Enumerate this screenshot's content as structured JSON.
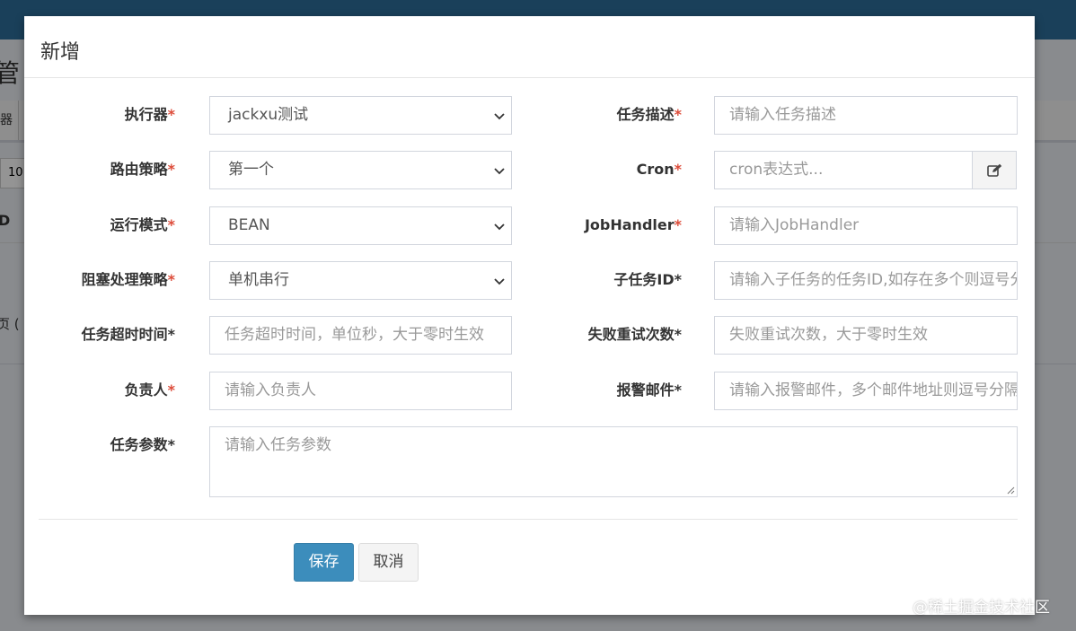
{
  "background": {
    "title_fragment": "管",
    "table_cell": "器",
    "page_size": "10",
    "id_col": "D",
    "page_info": "页 ( 总"
  },
  "modal": {
    "title": "新增",
    "fields": {
      "executor": {
        "label": "执行器",
        "required_mark": "*",
        "value": "jackxu测试"
      },
      "job_desc": {
        "label": "任务描述",
        "required_mark": "*",
        "placeholder": "请输入任务描述"
      },
      "route_strategy": {
        "label": "路由策略",
        "required_mark": "*",
        "value": "第一个"
      },
      "cron": {
        "label": "Cron",
        "required_mark": "*",
        "placeholder": "cron表达式...",
        "icon": "edit-icon"
      },
      "run_mode": {
        "label": "运行模式",
        "required_mark": "*",
        "value": "BEAN"
      },
      "job_handler": {
        "label": "JobHandler",
        "required_mark": "*",
        "placeholder": "请输入JobHandler"
      },
      "block_strategy": {
        "label": "阻塞处理策略",
        "required_mark": "*",
        "value": "单机串行"
      },
      "child_job_id": {
        "label": "子任务ID",
        "required_mark": "*",
        "placeholder": "请输入子任务的任务ID,如存在多个则逗号分隔"
      },
      "timeout": {
        "label": "任务超时时间",
        "required_mark": "*",
        "placeholder": "任务超时时间，单位秒，大于零时生效"
      },
      "fail_retry": {
        "label": "失败重试次数",
        "required_mark": "*",
        "placeholder": "失败重试次数，大于零时生效"
      },
      "author": {
        "label": "负责人",
        "required_mark": "*",
        "placeholder": "请输入负责人"
      },
      "alarm_email": {
        "label": "报警邮件",
        "required_mark": "*",
        "placeholder": "请输入报警邮件，多个邮件地址则逗号分隔"
      },
      "job_param": {
        "label": "任务参数",
        "required_mark": "*",
        "placeholder": "请输入任务参数"
      }
    },
    "buttons": {
      "save": "保存",
      "cancel": "取消"
    }
  },
  "watermark": "@稀土掘金技术社区",
  "colors": {
    "header": "#2d6f9b",
    "primary": "#3c8dbc",
    "required": "#dd4b39"
  }
}
